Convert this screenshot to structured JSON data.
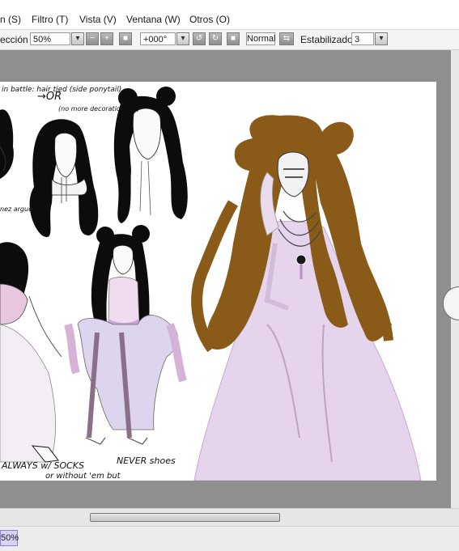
{
  "menu": {
    "items": [
      "n (S)",
      "Filtro (T)",
      "Vista (V)",
      "Ventana (W)",
      "Otros (O)"
    ]
  },
  "toolbar": {
    "selection_label": "ección",
    "zoom_value": "50%",
    "rotation_value": "+000°",
    "blend_mode": "Normal",
    "stabilizer_label": "Estabilizador",
    "stabilizer_value": "3"
  },
  "canvas": {
    "notes": {
      "hair_note": "in battle: hair tied (side ponytail)",
      "or_arrow": "→OR",
      "no_decoration": "(no more decoration yet)",
      "side_note": "nez argue",
      "footer_always": "ALWAYS w/ SOCKS",
      "footer_without": "or without 'em but",
      "footer_never": "NEVER shoes"
    }
  },
  "status": {
    "zoom": "50%"
  },
  "colors": {
    "menubar_bg": "#ffffff",
    "workspace_bg": "#8f8f8f",
    "paper": "#ffffff",
    "dress": "#e6d4ec",
    "hair_brown": "#8a5a19",
    "hair_black": "#0c0c0c",
    "zoom_badge": "#d8d2f7"
  }
}
